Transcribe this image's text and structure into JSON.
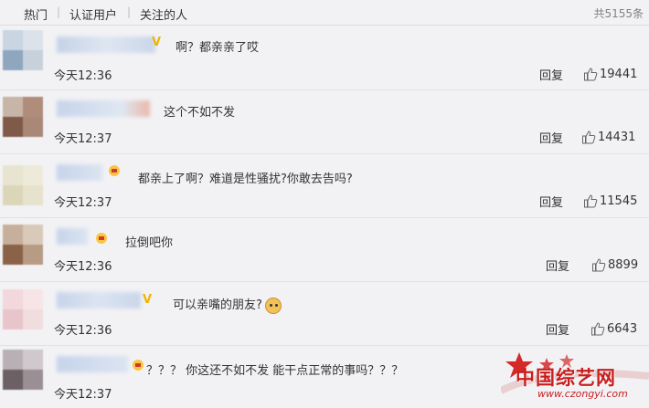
{
  "tabs": [
    {
      "label": "热门"
    },
    {
      "label": "认证用户"
    },
    {
      "label": "关注的人"
    }
  ],
  "tab_separator": "|",
  "total_label": "共5155条",
  "reply_label": "回复",
  "comments": [
    {
      "text": "啊？都亲亲了哎",
      "time": "今天12:36",
      "likes": "19441",
      "badge": "vip"
    },
    {
      "text": "这个不如不发",
      "time": "今天12:37",
      "likes": "14431",
      "badge": "none"
    },
    {
      "text": "都亲上了啊？难道是性骚扰?你敢去告吗?",
      "time": "今天12:37",
      "likes": "11545",
      "badge": "crown"
    },
    {
      "text": "拉倒吧你",
      "time": "今天12:36",
      "likes": "8899",
      "badge": "crown"
    },
    {
      "text": "可以亲嘴的朋友?",
      "time": "今天12:36",
      "likes": "6643",
      "badge": "vip",
      "emoji": "doge-icon"
    },
    {
      "text": "？？？ 你这还不如不发 能干点正常的事吗？？？",
      "time": "今天12:37",
      "likes": "",
      "badge": "crown"
    }
  ],
  "watermark": {
    "brand": "中国综艺网",
    "url": "www.czongyi.com"
  },
  "colors": {
    "background": "#f2f2f5",
    "text": "#333333",
    "muted": "#808080",
    "divider": "#e2e2e6",
    "vip_badge": "#f0b400"
  }
}
